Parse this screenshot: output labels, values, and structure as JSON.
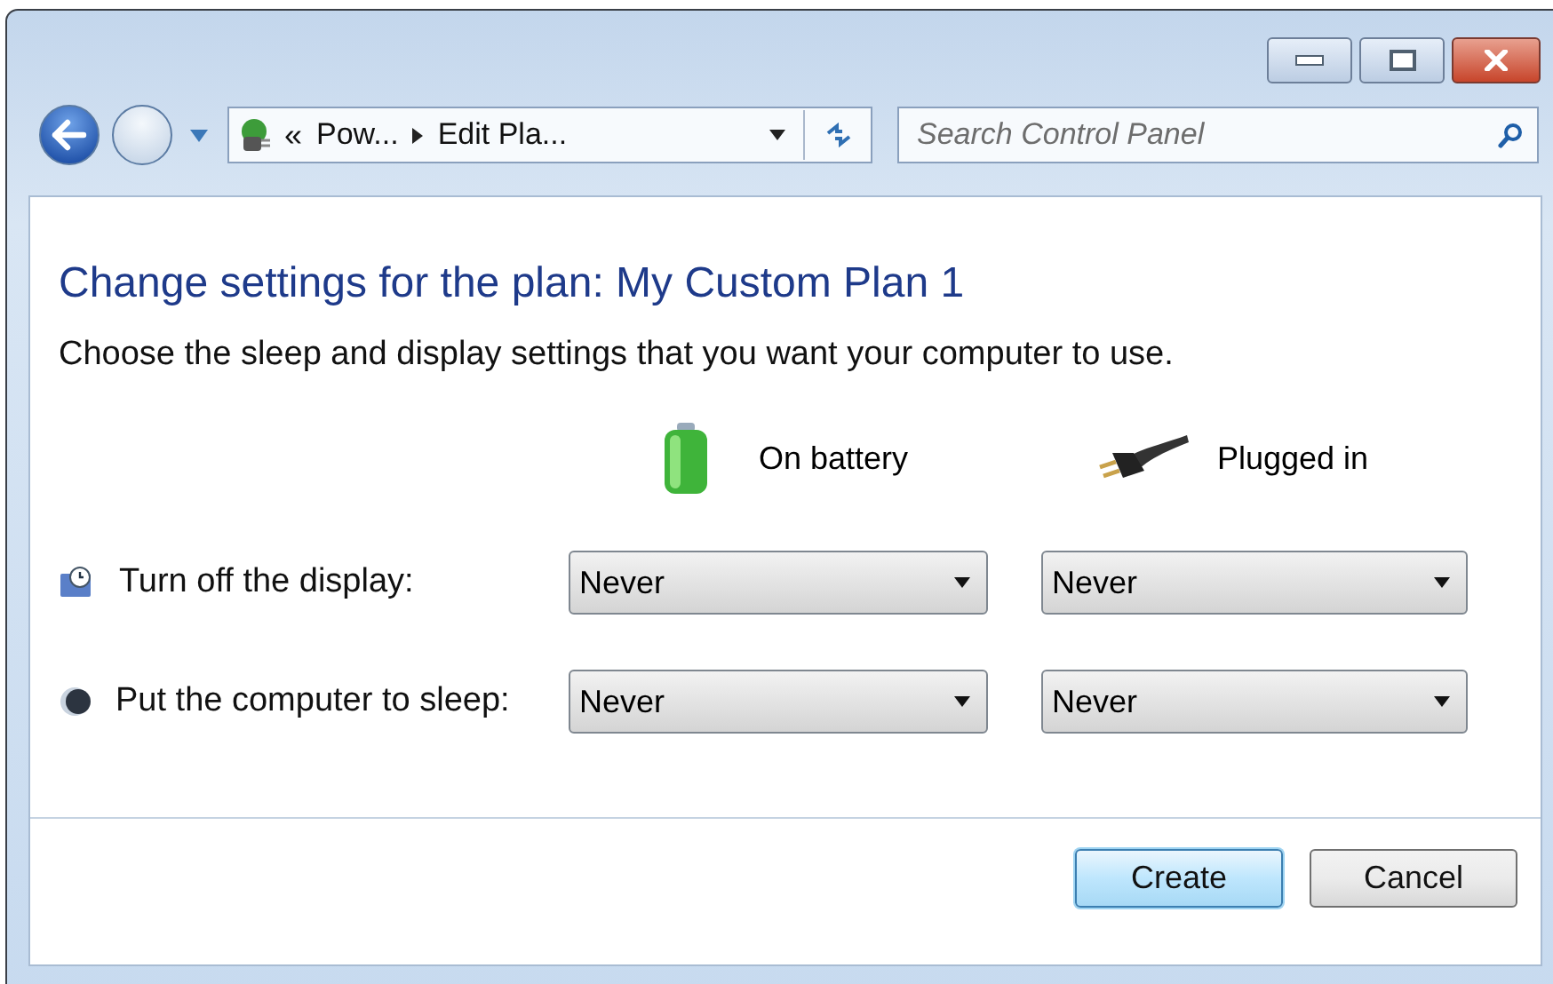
{
  "address_bar": {
    "overflow": "«",
    "breadcrumbs": [
      "Pow...",
      "Edit Pla..."
    ]
  },
  "search": {
    "placeholder": "Search Control Panel"
  },
  "heading": "Change settings for the plan: My Custom Plan 1",
  "description": "Choose the sleep and display settings that you want your computer to use.",
  "columns": [
    {
      "kind": "battery",
      "label": "On battery"
    },
    {
      "kind": "plug",
      "label": "Plugged in"
    }
  ],
  "settings": [
    {
      "kind": "display",
      "label": "Turn off the display:",
      "values": [
        "Never",
        "Never"
      ]
    },
    {
      "kind": "sleep",
      "label": "Put the computer to sleep:",
      "values": [
        "Never",
        "Never"
      ]
    }
  ],
  "buttons": [
    {
      "label": "Create",
      "default": true
    },
    {
      "label": "Cancel",
      "default": false
    }
  ]
}
